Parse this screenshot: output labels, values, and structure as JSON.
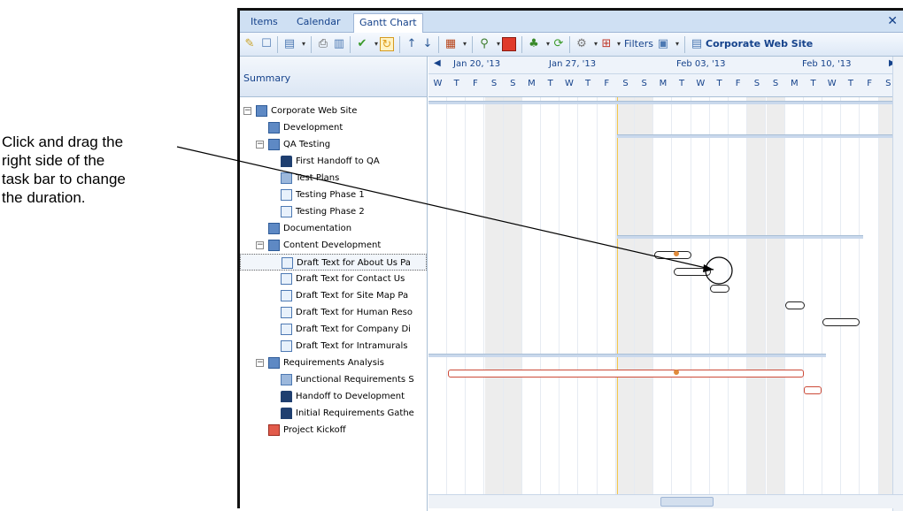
{
  "callout": {
    "line1": "Click and drag the",
    "line2": "right side of the",
    "line3": "task bar to change",
    "line4": "the duration."
  },
  "tabs": [
    {
      "label": "Items"
    },
    {
      "label": "Calendar"
    },
    {
      "label": "Gantt Chart"
    }
  ],
  "toolbar": {
    "filters_label": "Filters",
    "project_label": "Corporate Web Site"
  },
  "summary_header": "Summary",
  "timeline": {
    "weeks": [
      "Jan 20, '13",
      "Jan 27, '13",
      "Feb 03, '13",
      "Feb 10, '13"
    ],
    "days": [
      "W",
      "T",
      "F",
      "S",
      "S",
      "M",
      "T",
      "W",
      "T",
      "F",
      "S",
      "S",
      "M",
      "T",
      "W",
      "T",
      "F",
      "S",
      "S",
      "M",
      "T",
      "W",
      "T",
      "F",
      "S"
    ]
  },
  "tasks": [
    {
      "label": "Corporate Web Site",
      "icon": "summary-icon"
    },
    {
      "label": "Development",
      "icon": "summary-icon"
    },
    {
      "label": "QA Testing",
      "icon": "summary-icon"
    },
    {
      "label": "First Handoff to QA",
      "icon": "milestone-icon"
    },
    {
      "label": "Test Plans",
      "icon": "summary-task-icon"
    },
    {
      "label": "Testing Phase 1",
      "icon": "task-icon"
    },
    {
      "label": "Testing Phase 2",
      "icon": "task-icon"
    },
    {
      "label": "Documentation",
      "icon": "summary-icon"
    },
    {
      "label": "Content Development",
      "icon": "summary-icon"
    },
    {
      "label": "Draft Text for About Us Pa",
      "icon": "task-icon"
    },
    {
      "label": "Draft Text for Contact Us",
      "icon": "task-icon"
    },
    {
      "label": "Draft Text for Site Map Pa",
      "icon": "task-icon"
    },
    {
      "label": "Draft Text for Human Reso",
      "icon": "task-icon"
    },
    {
      "label": "Draft Text for Company Di",
      "icon": "task-icon"
    },
    {
      "label": "Draft Text for Intramurals",
      "icon": "task-icon"
    },
    {
      "label": "Requirements Analysis",
      "icon": "summary-icon"
    },
    {
      "label": "Functional Requirements S",
      "icon": "summary-task-icon"
    },
    {
      "label": "Handoff to Development",
      "icon": "milestone-icon"
    },
    {
      "label": "Initial Requirements Gathe",
      "icon": "milestone-icon"
    },
    {
      "label": "Project Kickoff",
      "icon": "project-icon"
    }
  ],
  "colors": {
    "accent": "#15428b",
    "critical": "#cc4a38",
    "today_line": "#f5c84b",
    "weekend": "#ededed"
  }
}
